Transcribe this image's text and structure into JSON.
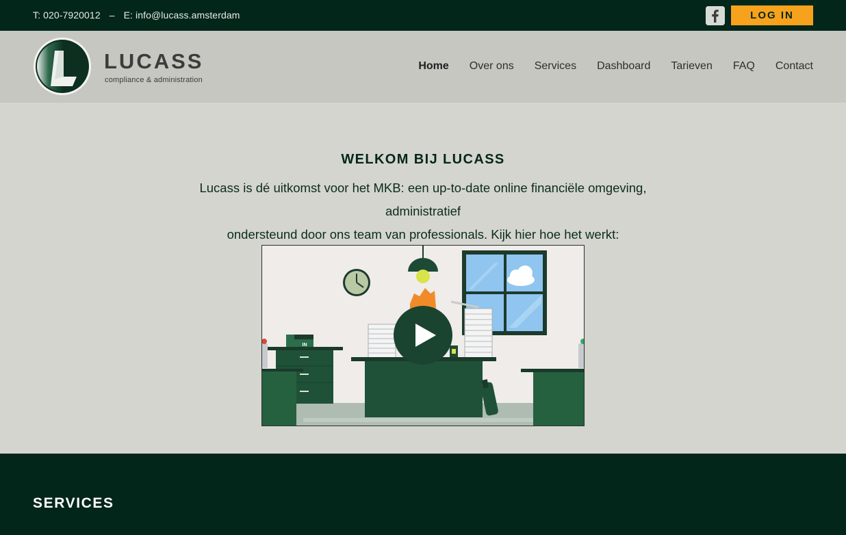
{
  "topbar": {
    "phone": "T: 020-7920012",
    "separator": "–",
    "email": "E: info@lucass.amsterdam",
    "facebook_icon": "facebook-icon",
    "login_label": "LOG IN",
    "colors": {
      "background": "#03261a",
      "login": "#f6a21d"
    }
  },
  "header": {
    "logo_name": "LUCASS",
    "logo_tagline": "compliance & administration",
    "nav": [
      {
        "label": "Home",
        "active": true
      },
      {
        "label": "Over ons"
      },
      {
        "label": "Services"
      },
      {
        "label": "Dashboard"
      },
      {
        "label": "Tarieven"
      },
      {
        "label": "FAQ"
      },
      {
        "label": "Contact"
      }
    ]
  },
  "hero": {
    "title": "WELKOM BIJ LUCASS",
    "text_line1": "Lucass is dé uitkomst voor het MKB: een up-to-date online financiële omgeving, administratief",
    "text_line2": "ondersteund door ons team van professionals. Kijk hier hoe het werkt:",
    "video_play_icon": "play-icon",
    "video_in_tray_label": "IN"
  },
  "services": {
    "title": "SERVICES"
  }
}
